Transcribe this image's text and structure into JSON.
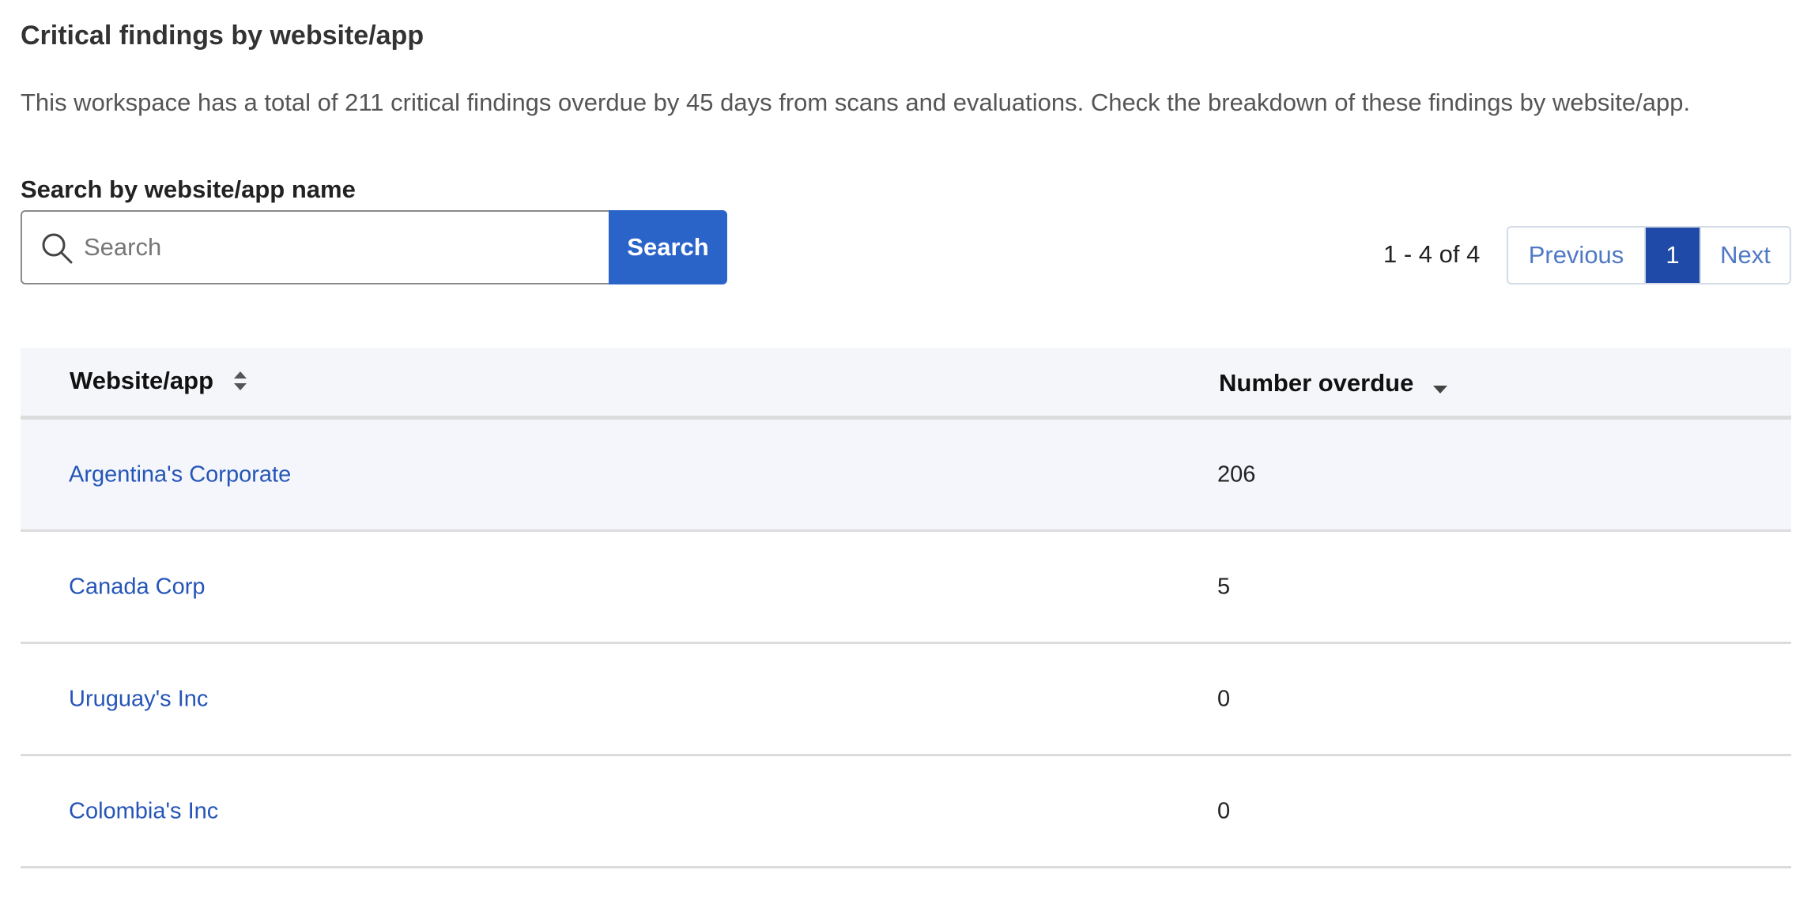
{
  "section": {
    "title": "Critical findings by website/app",
    "description": "This workspace has a total of 211 critical findings overdue by 45 days from scans and evaluations. Check the breakdown of these findings by website/app."
  },
  "search": {
    "label": "Search by website/app name",
    "placeholder": "Search",
    "value": "",
    "button_label": "Search",
    "icon": "search-icon"
  },
  "pagination": {
    "range_text": "1 - 4 of 4",
    "previous_label": "Previous",
    "current_page": "1",
    "next_label": "Next"
  },
  "table": {
    "columns": [
      {
        "label": "Website/app",
        "sort": "unsorted",
        "icon": "sort-both-icon"
      },
      {
        "label": "Number overdue",
        "sort": "descending",
        "icon": "sort-down-icon"
      }
    ],
    "rows": [
      {
        "name": "Argentina's Corporate",
        "overdue": "206"
      },
      {
        "name": "Canada Corp",
        "overdue": "5"
      },
      {
        "name": "Uruguay's Inc",
        "overdue": "0"
      },
      {
        "name": "Colombia's Inc",
        "overdue": "0"
      }
    ]
  },
  "colors": {
    "primary_button": "#2b64c8",
    "active_page": "#1f4aa8",
    "link": "#2555b8",
    "header_bg": "#f4f6fa"
  }
}
